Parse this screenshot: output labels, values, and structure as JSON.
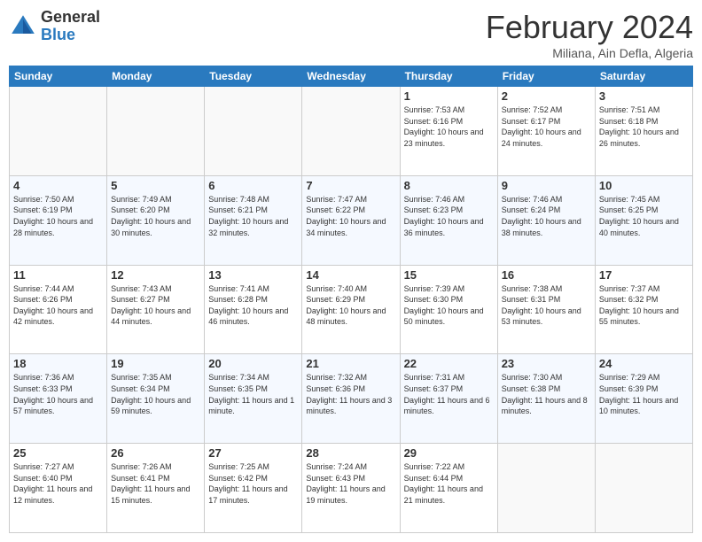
{
  "logo": {
    "general": "General",
    "blue": "Blue"
  },
  "title": "February 2024",
  "subtitle": "Miliana, Ain Defla, Algeria",
  "days_header": [
    "Sunday",
    "Monday",
    "Tuesday",
    "Wednesday",
    "Thursday",
    "Friday",
    "Saturday"
  ],
  "weeks": [
    [
      {
        "day": "",
        "info": ""
      },
      {
        "day": "",
        "info": ""
      },
      {
        "day": "",
        "info": ""
      },
      {
        "day": "",
        "info": ""
      },
      {
        "day": "1",
        "info": "Sunrise: 7:53 AM\nSunset: 6:16 PM\nDaylight: 10 hours\nand 23 minutes."
      },
      {
        "day": "2",
        "info": "Sunrise: 7:52 AM\nSunset: 6:17 PM\nDaylight: 10 hours\nand 24 minutes."
      },
      {
        "day": "3",
        "info": "Sunrise: 7:51 AM\nSunset: 6:18 PM\nDaylight: 10 hours\nand 26 minutes."
      }
    ],
    [
      {
        "day": "4",
        "info": "Sunrise: 7:50 AM\nSunset: 6:19 PM\nDaylight: 10 hours\nand 28 minutes."
      },
      {
        "day": "5",
        "info": "Sunrise: 7:49 AM\nSunset: 6:20 PM\nDaylight: 10 hours\nand 30 minutes."
      },
      {
        "day": "6",
        "info": "Sunrise: 7:48 AM\nSunset: 6:21 PM\nDaylight: 10 hours\nand 32 minutes."
      },
      {
        "day": "7",
        "info": "Sunrise: 7:47 AM\nSunset: 6:22 PM\nDaylight: 10 hours\nand 34 minutes."
      },
      {
        "day": "8",
        "info": "Sunrise: 7:46 AM\nSunset: 6:23 PM\nDaylight: 10 hours\nand 36 minutes."
      },
      {
        "day": "9",
        "info": "Sunrise: 7:46 AM\nSunset: 6:24 PM\nDaylight: 10 hours\nand 38 minutes."
      },
      {
        "day": "10",
        "info": "Sunrise: 7:45 AM\nSunset: 6:25 PM\nDaylight: 10 hours\nand 40 minutes."
      }
    ],
    [
      {
        "day": "11",
        "info": "Sunrise: 7:44 AM\nSunset: 6:26 PM\nDaylight: 10 hours\nand 42 minutes."
      },
      {
        "day": "12",
        "info": "Sunrise: 7:43 AM\nSunset: 6:27 PM\nDaylight: 10 hours\nand 44 minutes."
      },
      {
        "day": "13",
        "info": "Sunrise: 7:41 AM\nSunset: 6:28 PM\nDaylight: 10 hours\nand 46 minutes."
      },
      {
        "day": "14",
        "info": "Sunrise: 7:40 AM\nSunset: 6:29 PM\nDaylight: 10 hours\nand 48 minutes."
      },
      {
        "day": "15",
        "info": "Sunrise: 7:39 AM\nSunset: 6:30 PM\nDaylight: 10 hours\nand 50 minutes."
      },
      {
        "day": "16",
        "info": "Sunrise: 7:38 AM\nSunset: 6:31 PM\nDaylight: 10 hours\nand 53 minutes."
      },
      {
        "day": "17",
        "info": "Sunrise: 7:37 AM\nSunset: 6:32 PM\nDaylight: 10 hours\nand 55 minutes."
      }
    ],
    [
      {
        "day": "18",
        "info": "Sunrise: 7:36 AM\nSunset: 6:33 PM\nDaylight: 10 hours\nand 57 minutes."
      },
      {
        "day": "19",
        "info": "Sunrise: 7:35 AM\nSunset: 6:34 PM\nDaylight: 10 hours\nand 59 minutes."
      },
      {
        "day": "20",
        "info": "Sunrise: 7:34 AM\nSunset: 6:35 PM\nDaylight: 11 hours\nand 1 minute."
      },
      {
        "day": "21",
        "info": "Sunrise: 7:32 AM\nSunset: 6:36 PM\nDaylight: 11 hours\nand 3 minutes."
      },
      {
        "day": "22",
        "info": "Sunrise: 7:31 AM\nSunset: 6:37 PM\nDaylight: 11 hours\nand 6 minutes."
      },
      {
        "day": "23",
        "info": "Sunrise: 7:30 AM\nSunset: 6:38 PM\nDaylight: 11 hours\nand 8 minutes."
      },
      {
        "day": "24",
        "info": "Sunrise: 7:29 AM\nSunset: 6:39 PM\nDaylight: 11 hours\nand 10 minutes."
      }
    ],
    [
      {
        "day": "25",
        "info": "Sunrise: 7:27 AM\nSunset: 6:40 PM\nDaylight: 11 hours\nand 12 minutes."
      },
      {
        "day": "26",
        "info": "Sunrise: 7:26 AM\nSunset: 6:41 PM\nDaylight: 11 hours\nand 15 minutes."
      },
      {
        "day": "27",
        "info": "Sunrise: 7:25 AM\nSunset: 6:42 PM\nDaylight: 11 hours\nand 17 minutes."
      },
      {
        "day": "28",
        "info": "Sunrise: 7:24 AM\nSunset: 6:43 PM\nDaylight: 11 hours\nand 19 minutes."
      },
      {
        "day": "29",
        "info": "Sunrise: 7:22 AM\nSunset: 6:44 PM\nDaylight: 11 hours\nand 21 minutes."
      },
      {
        "day": "",
        "info": ""
      },
      {
        "day": "",
        "info": ""
      }
    ]
  ]
}
